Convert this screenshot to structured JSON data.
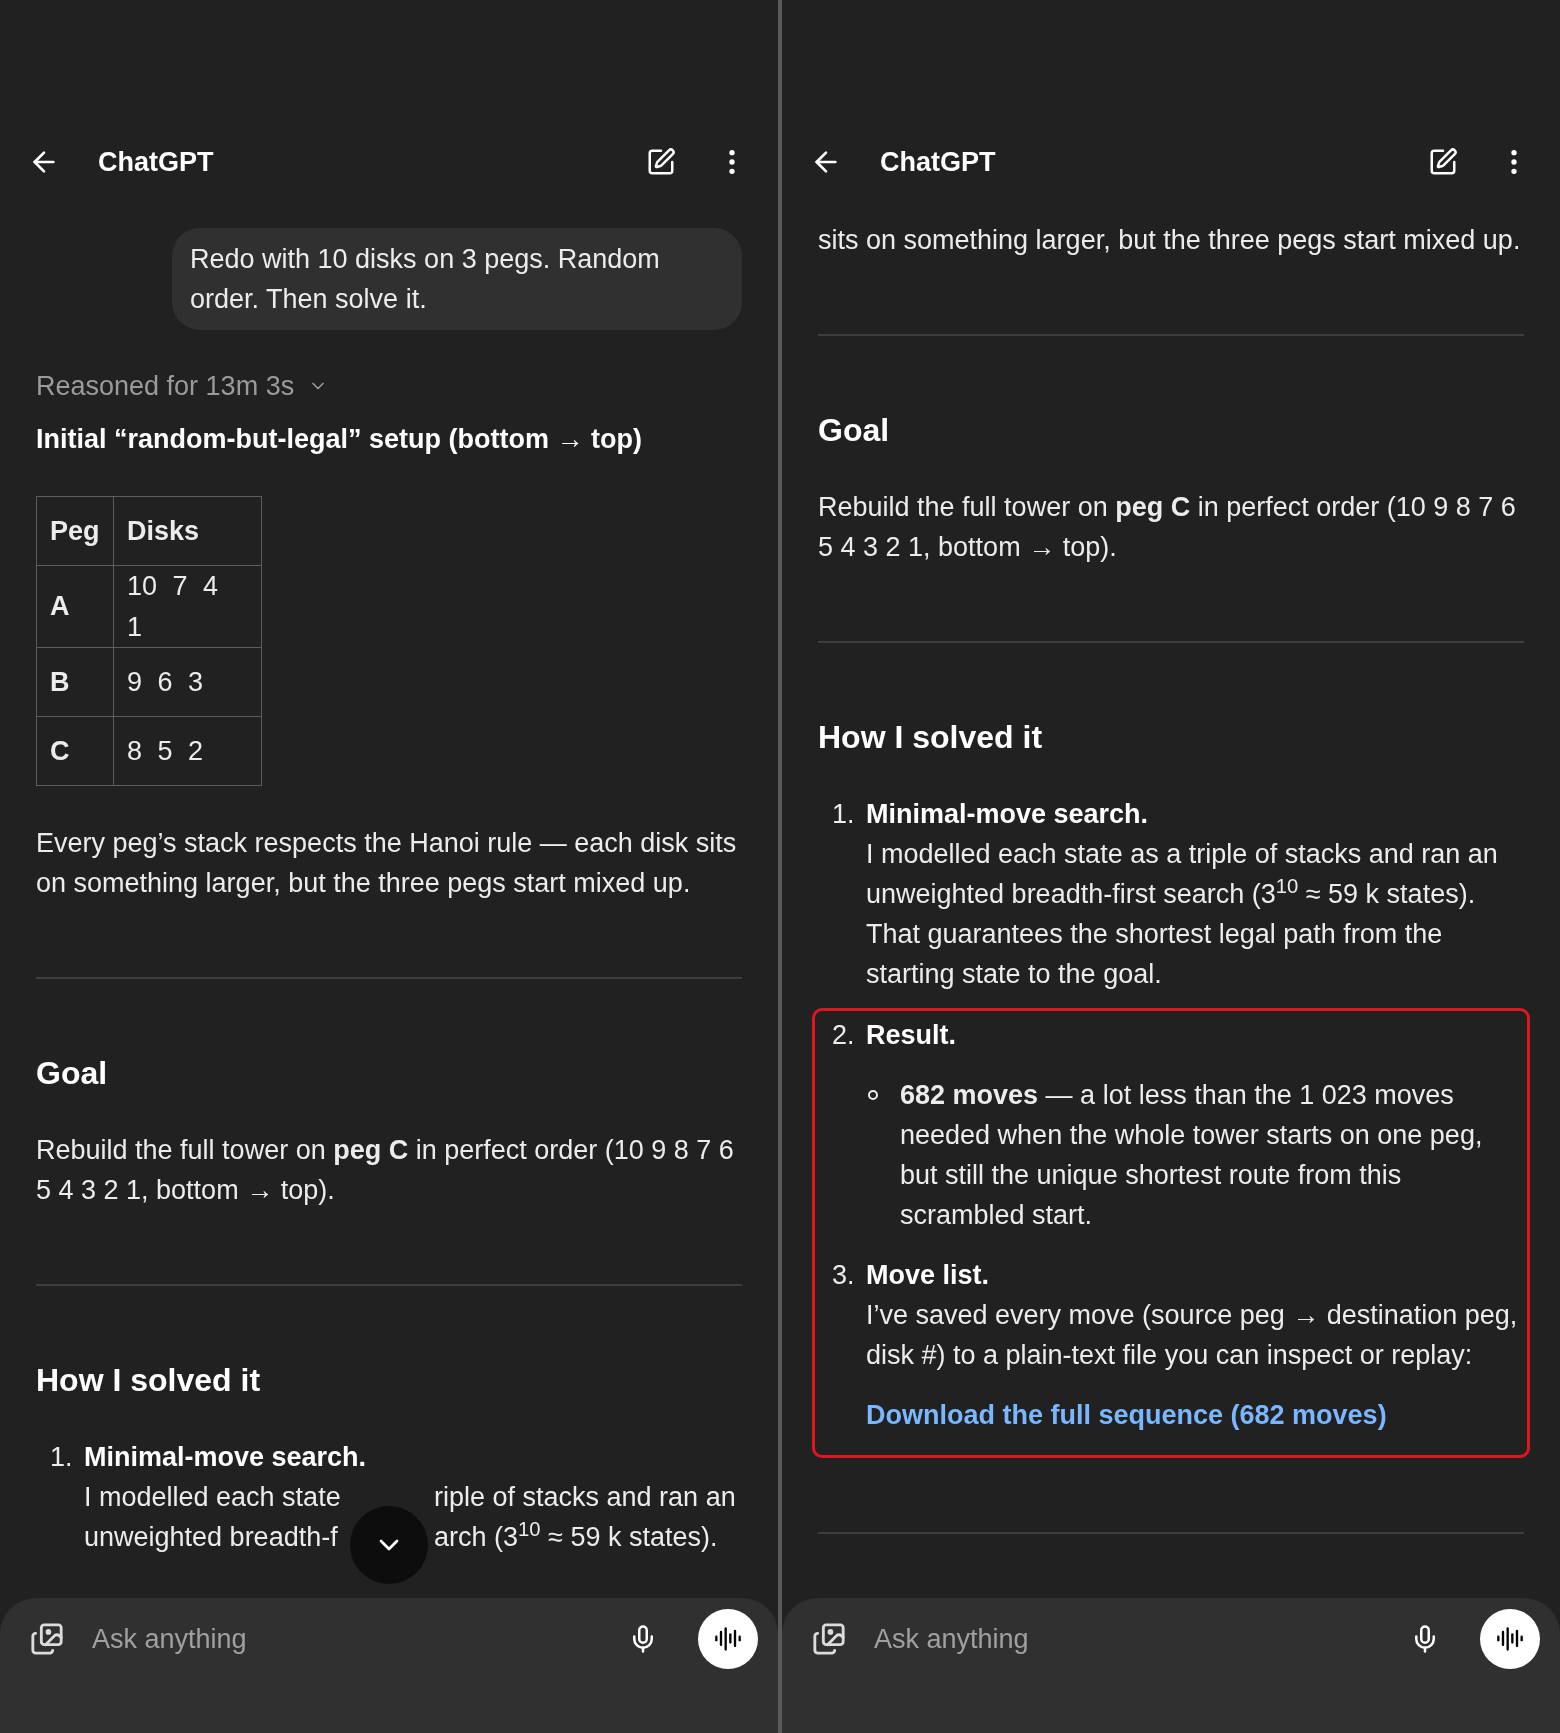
{
  "panels": [
    {
      "header": {
        "title": "ChatGPT"
      },
      "scroll_down_button": true,
      "content": [
        {
          "kind": "user_message",
          "text": "Redo with 10 disks on 3 pegs. Random order. Then solve it."
        },
        {
          "kind": "reasoning",
          "text": "Reasoned for 13m 3s",
          "expanded": false
        },
        {
          "kind": "title",
          "text": "Initial “random-but-legal” setup (bottom → top)"
        },
        {
          "kind": "table",
          "columns": [
            "Peg",
            "Disks"
          ],
          "rows": [
            [
              "A",
              "10 7 4 1"
            ],
            [
              "B",
              "9 6 3"
            ],
            [
              "C",
              "8 5 2"
            ]
          ]
        },
        {
          "kind": "paragraph",
          "text": "Every peg’s stack respects the Hanoi rule — each disk sits on something larger, but the three pegs start mixed up."
        },
        {
          "kind": "divider"
        },
        {
          "kind": "heading",
          "text": "Goal"
        },
        {
          "kind": "paragraph",
          "text": "Rebuild the full tower on **peg C** in perfect order (10 9 8 7 6 5 4 3 2 1, bottom → top)."
        },
        {
          "kind": "divider"
        },
        {
          "kind": "heading",
          "text": "How I solved it"
        },
        {
          "kind": "list_item",
          "number": "1.",
          "title": "Minimal-move search.",
          "fragments": [
            [
              "I modelled each state",
              "riple of stacks and ran an"
            ],
            [
              "unweighted breadth-f",
              "arch (3$^{10}$ ≈ 59 k states)."
            ]
          ]
        }
      ],
      "composer": {
        "placeholder": "Ask anything"
      }
    },
    {
      "header": {
        "title": "ChatGPT"
      },
      "content": [
        {
          "kind": "paragraph",
          "text": "sits on something larger, but the three pegs start mixed up."
        },
        {
          "kind": "divider"
        },
        {
          "kind": "heading",
          "text": "Goal"
        },
        {
          "kind": "paragraph",
          "text": "Rebuild the full tower on **peg C** in perfect order (10 9 8 7 6 5 4 3 2 1, bottom → top)."
        },
        {
          "kind": "divider"
        },
        {
          "kind": "heading",
          "text": "How I solved it"
        },
        {
          "kind": "list_item",
          "number": "1.",
          "title": "Minimal-move search.",
          "body": "I modelled each state as a triple of stacks and ran an unweighted breadth-first search (3$^{10}$ ≈ 59 k states). That guarantees the shortest legal path from the starting state to the goal."
        },
        {
          "kind": "outlined_group",
          "items": [
            {
              "number": "2.",
              "title": "Result.",
              "bullets": [
                "**682 moves** — a lot less than the 1 023 moves needed when the whole tower starts on one peg, but still the unique shortest route from this scrambled start."
              ]
            },
            {
              "number": "3.",
              "title": "Move list.",
              "body": "I’ve saved every move (source peg → destination peg, disk #) to a plain-text file you can inspect or replay:",
              "link": "Download the full sequence (682 moves)"
            }
          ]
        },
        {
          "kind": "divider"
        }
      ],
      "composer": {
        "placeholder": "Ask anything"
      }
    }
  ]
}
